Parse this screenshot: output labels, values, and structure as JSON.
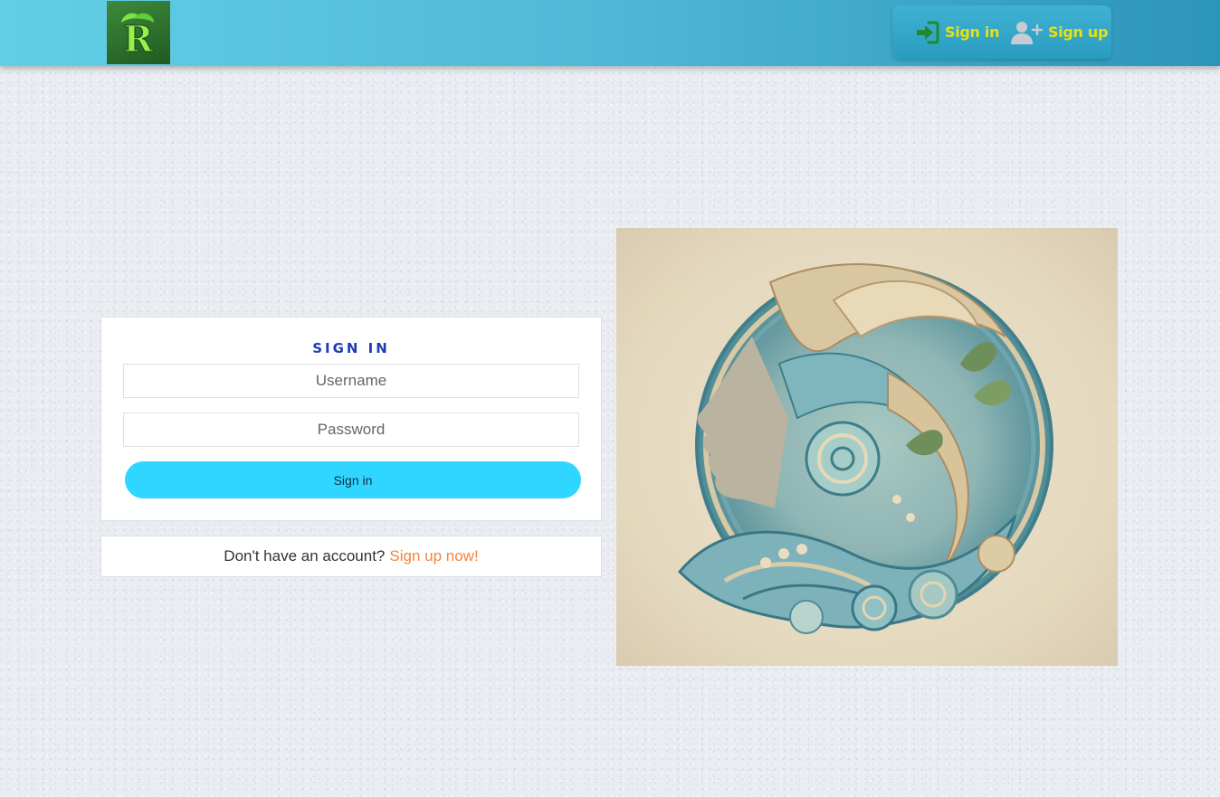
{
  "header": {
    "logo_icon": "leaf-r-logo-icon",
    "nav": {
      "signin_label": "Sign in",
      "signup_label": "Sign up",
      "signin_icon": "sign-in-icon",
      "signup_icon": "user-plus-icon"
    }
  },
  "login": {
    "title": "SIGN IN",
    "username_placeholder": "Username",
    "password_placeholder": "Password",
    "submit_label": "Sign in"
  },
  "signup_prompt": {
    "text": "Don't have an account?",
    "link": "Sign up now!"
  },
  "colors": {
    "title": "#1d3fae",
    "button": "#2fd6ff",
    "link": "#f4853b",
    "nav_text": "#e6e017",
    "nav_icon_signin": "#1e8a2c"
  }
}
